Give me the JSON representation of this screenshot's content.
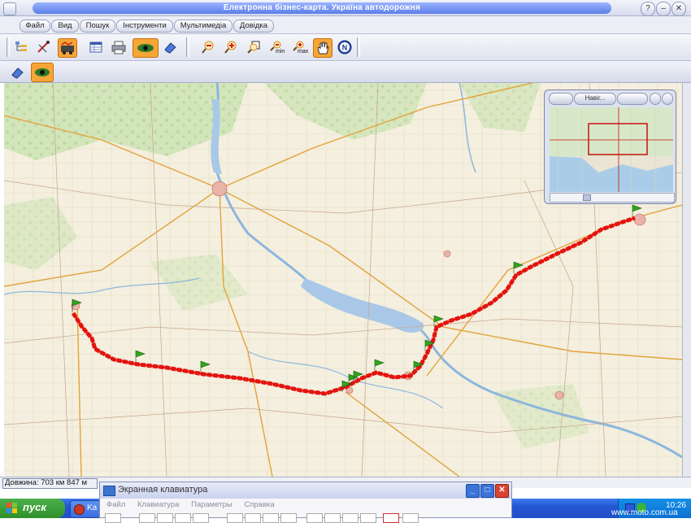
{
  "window": {
    "title": "Електронна бізнес-карта. Україна автодорожня",
    "controls": [
      "?",
      "–",
      "✕"
    ]
  },
  "menu": {
    "items": [
      "Файл",
      "Вид",
      "Пошук",
      "Інструменти",
      "Мультимедіа",
      "Довідка"
    ]
  },
  "toolbar_primary": {
    "groups": [
      [
        "layers-tree",
        "ruler-tool",
        "route-tool",
        "table-tool",
        "print-tool",
        "view-tool",
        "eraser-tool"
      ],
      [
        "zoom-out",
        "zoom-in",
        "zoom-rect",
        "zoom-min",
        "zoom-max",
        "pan-hand",
        "north-compass"
      ]
    ],
    "zoom_min_label": "min",
    "zoom_max_label": "max"
  },
  "toolbar_secondary": {
    "items": [
      "eraser-tool",
      "view-tool"
    ]
  },
  "overview": {
    "title": "Навіг..."
  },
  "status": {
    "length": "Довжина: 703 км 847 м"
  },
  "keyboard": {
    "title": "Экранная клавиатура",
    "menu": [
      "Файл",
      "Клавиатура",
      "Параметры",
      "Справка"
    ]
  },
  "taskbar": {
    "start_label": "пуск",
    "task_label": "Ka",
    "clock": "10:26"
  },
  "watermark": "www.moto.com.ua",
  "colors": {
    "route": "#e3140f",
    "water": "#a9c8e8",
    "active_tool": "#f7a636",
    "flag": "#2fa51e"
  },
  "route_flags": 12
}
